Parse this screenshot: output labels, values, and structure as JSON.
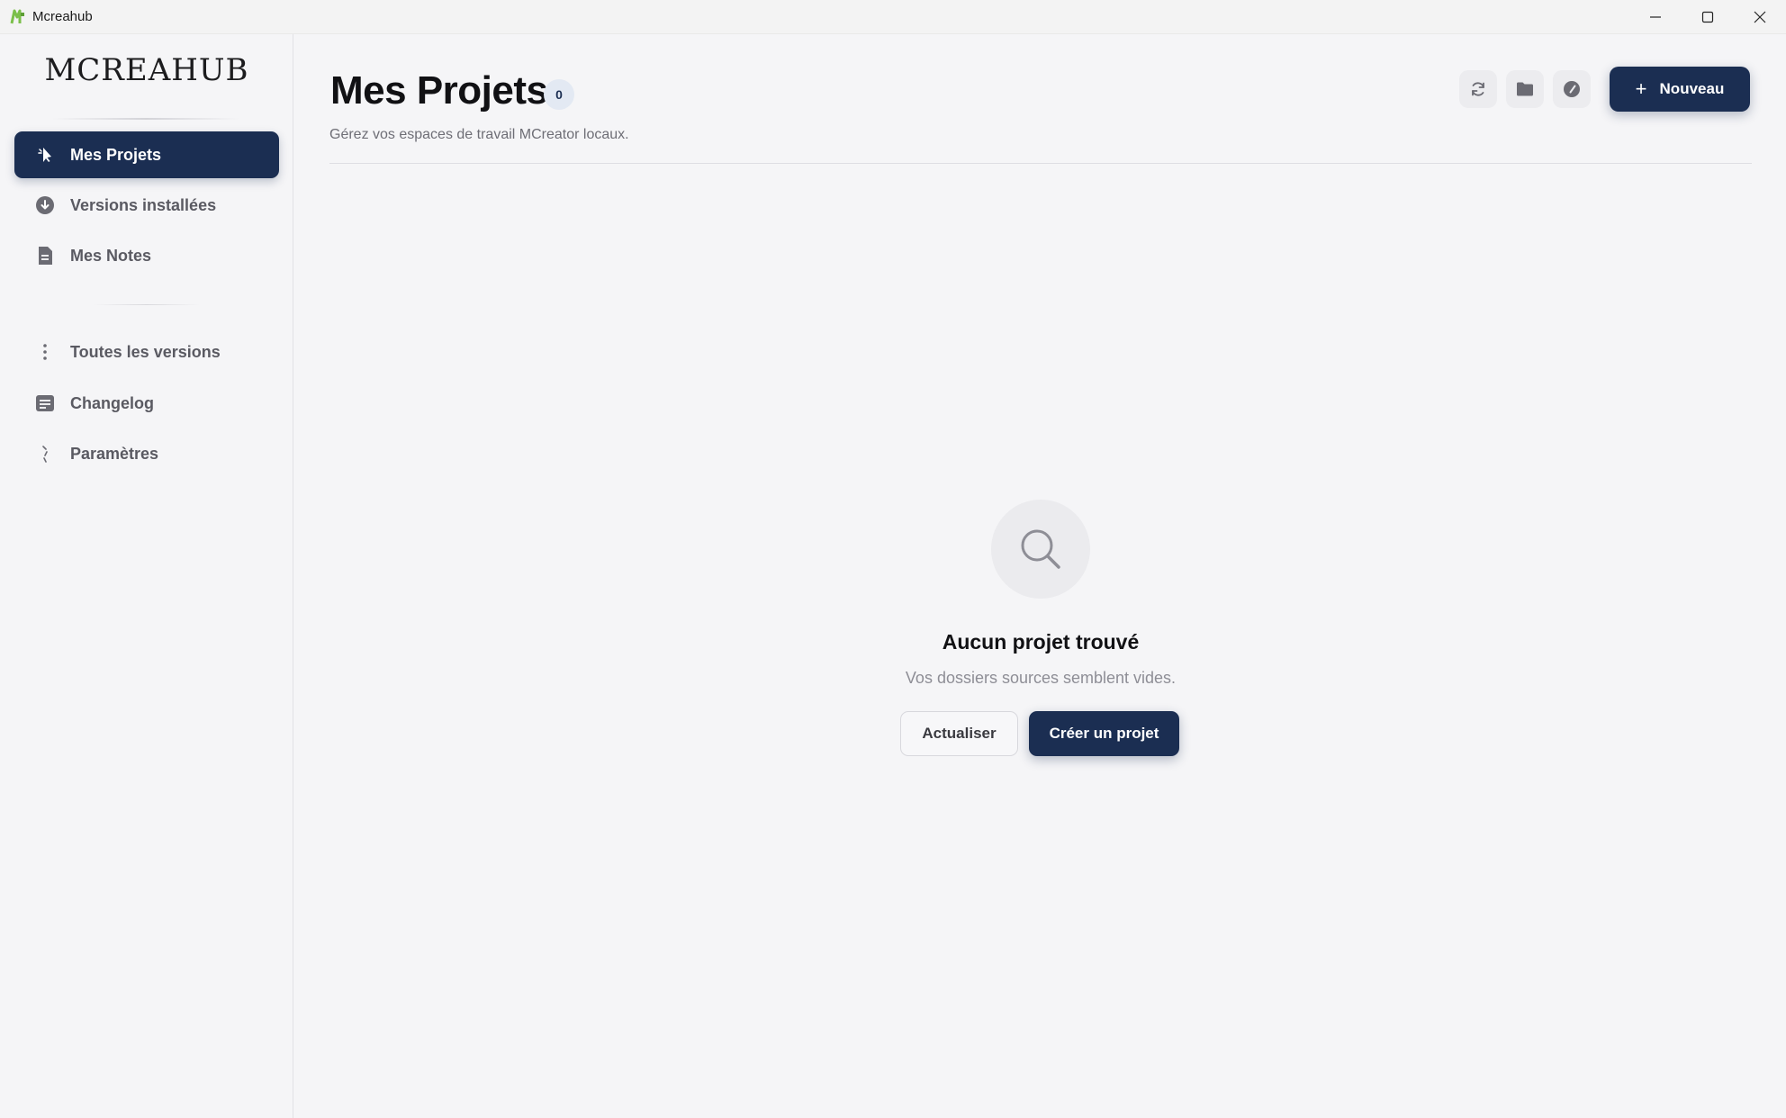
{
  "window": {
    "title": "Mcreahub",
    "controls": [
      "minimize-icon",
      "maximize-icon",
      "close-icon"
    ]
  },
  "sidebar": {
    "brand": "MCREAHUB",
    "items": [
      {
        "label": "Mes Projets",
        "icon": "cursor-icon",
        "active": true
      },
      {
        "label": "Versions installées",
        "icon": "download-circle-icon"
      },
      {
        "label": "Mes Notes",
        "icon": "note-icon"
      },
      {
        "label": "Toutes les versions",
        "icon": "more-vertical-icon"
      },
      {
        "label": "Changelog",
        "icon": "list-icon"
      },
      {
        "label": "Paramètres",
        "icon": "settings-icon"
      }
    ]
  },
  "header": {
    "title": "Mes Projets",
    "count": "0",
    "subtitle": "Gérez vos espaces de travail MCreator locaux.",
    "actions": [
      {
        "icon": "refresh-icon"
      },
      {
        "icon": "folder-icon"
      },
      {
        "icon": "compass-icon"
      }
    ],
    "new_button": {
      "icon": "plus-icon",
      "label": "Nouveau"
    }
  },
  "empty_state": {
    "icon": "search-icon",
    "title": "Aucun projet trouvé",
    "subtitle": "Vos dossiers sources semblent vides.",
    "refresh_label": "Actualiser",
    "create_label": "Créer un projet"
  },
  "colors": {
    "accent": "#1b2e52",
    "background": "#f5f5f7"
  }
}
